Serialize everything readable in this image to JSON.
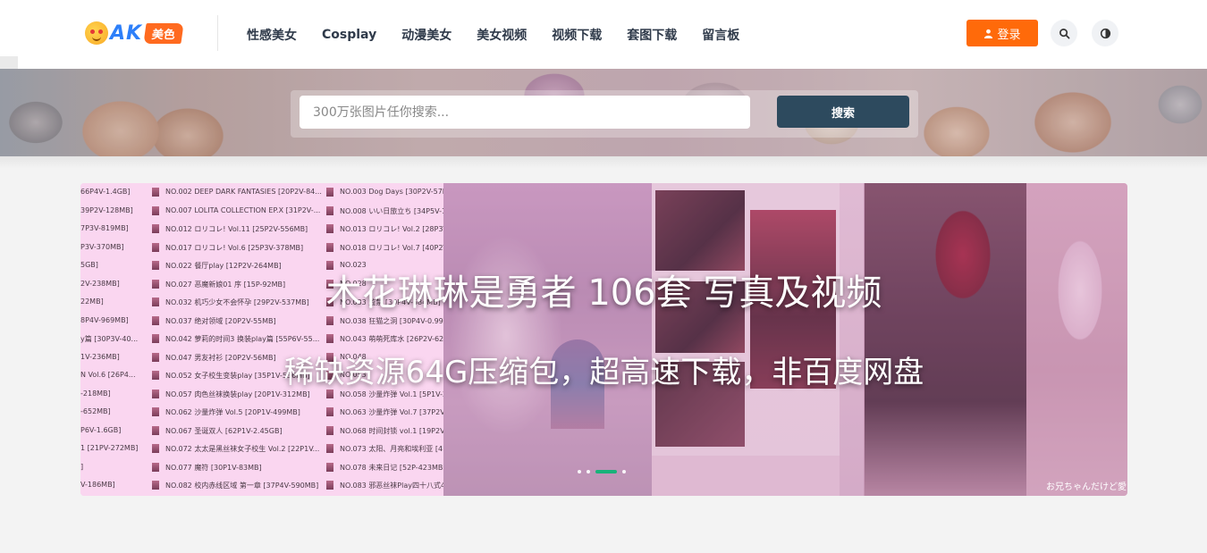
{
  "logo": {
    "brand": "AK",
    "tag": "美色"
  },
  "nav": {
    "items": [
      {
        "label": "性感美女"
      },
      {
        "label": "Cosplay"
      },
      {
        "label": "动漫美女"
      },
      {
        "label": "美女视频"
      },
      {
        "label": "视频下载"
      },
      {
        "label": "套图下载"
      },
      {
        "label": "留言板"
      }
    ]
  },
  "header": {
    "login_label": "登录",
    "search_icon": "search-icon",
    "theme_icon": "theme-toggle-icon"
  },
  "search": {
    "placeholder": "300万张图片任你搜索...",
    "button_label": "搜索"
  },
  "slider": {
    "title": "木花琳琳是勇者 106套 写真及视频",
    "subtitle": "稀缺资源64G压缩包，超高速下载，非百度网盘",
    "caption": "お兄ちゃんだけど愛",
    "list": [
      [
        "66P4V-1.4GB]",
        "NO.002 DEEP DARK FANTASIES [20P2V-84...",
        "NO.003 Dog Days [30P2V-57M"
      ],
      [
        "39P2V-128MB]",
        "NO.007 LOLITA COLLECTION EP.X [31P2V-...",
        "NO.008 いい日旅立ち [34P5V-19"
      ],
      [
        "7P3V-819MB]",
        "NO.012 ロリコレ! Vol.11 [25P2V-556MB]",
        "NO.013 ロリコレ! Vol.2 [28P3V"
      ],
      [
        "P3V-370MB]",
        "NO.017 ロリコレ! Vol.6 [25P3V-378MB]",
        "NO.018 ロリコレ! Vol.7 [40P2V"
      ],
      [
        "5GB]",
        "NO.022 餐厅play [12P2V-264MB]",
        "NO.023"
      ],
      [
        "2V-238MB]",
        "NO.027 恶魔新娘01 序 [15P-92MB]",
        "NO.028"
      ],
      [
        "22MB]",
        "NO.032 机巧少女不会怀孕 [29P2V-537MB]",
        "NO.033 监禁 [30P4V-584MB]"
      ],
      [
        "8P4V-969MB]",
        "NO.037 绝对领域 [20P2V-55MB]",
        "NO.038 狂猫之洞 [30P4V-0.99GE"
      ],
      [
        "y篇 [30P3V-40...",
        "NO.042 萝莉的时间3 换装play篇 [55P6V-55...",
        "NO.043 萌萌死库水 [26P2V-62M"
      ],
      [
        "1V-236MB]",
        "NO.047 男友衬衫 [20P2V-56MB]",
        "NO.048"
      ],
      [
        "N Vol.6 [26P4...",
        "NO.052 女子校生变装play [35P1V-536MB]",
        "NO.053"
      ],
      [
        "-218MB]",
        "NO.057 肉色丝袜换装play [20P1V-312MB]",
        "NO.058 沙量炸弹 Vol.1 [5P1V-23"
      ],
      [
        "-652MB]",
        "NO.062 沙量炸弹 Vol.5 [20P1V-499MB]",
        "NO.063 沙量炸弹 Vol.7 [37P2V-1"
      ],
      [
        "P6V-1.6GB]",
        "NO.067 圣诞双人 [62P1V-2.45GB]",
        "NO.068 时间封锁 vol.1 [19P2V-1"
      ],
      [
        "1 [21PV-272MB]",
        "NO.072 太太是黑丝袜女子校生 Vol.2 [22P1V...",
        "NO.073 太阳、月亮和埃利亚 [41P"
      ],
      [
        "]",
        "NO.077 魔符 [30P1V-83MB]",
        "NO.078 未来日记 [52P-423MB]"
      ],
      [
        "V-186MB]",
        "NO.082 校内赤线区域 第一章 [37P4V-590MB]",
        "NO.083 邪恶丝袜Play四十八式4 [E"
      ]
    ],
    "dots": 4,
    "active_dot": 2
  },
  "colors": {
    "accent": "#ff6a0a",
    "search_button": "#2d4a5e",
    "nav_text": "#2f3a4a",
    "active_dot": "#19b27a"
  }
}
